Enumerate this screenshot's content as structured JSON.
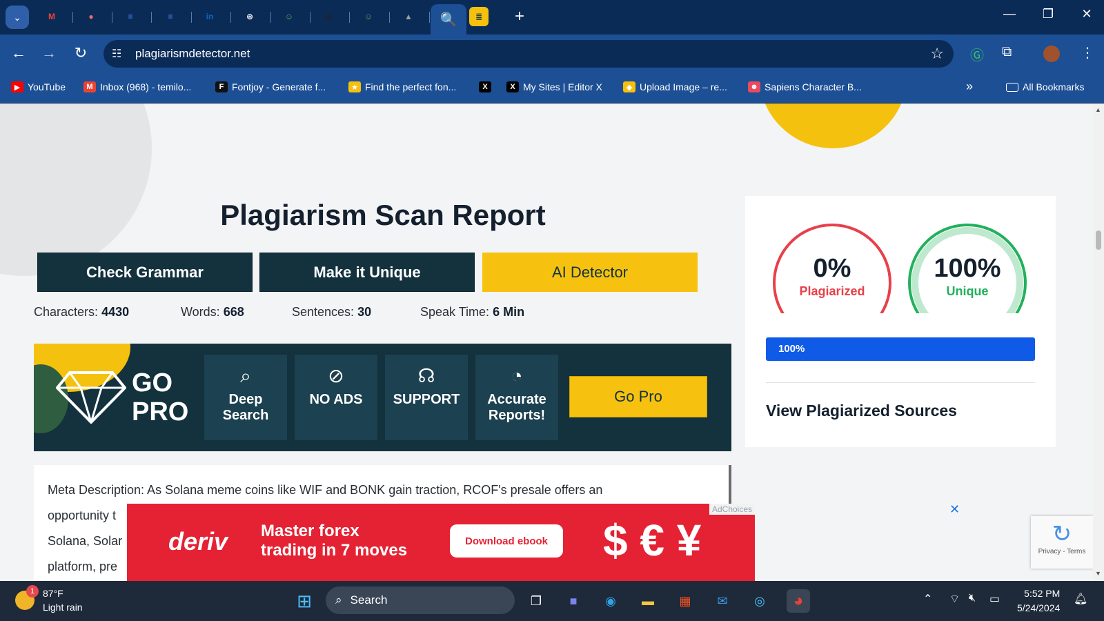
{
  "browser": {
    "url": "plagiarismdetector.net",
    "tabs": [
      {
        "name": "gmail",
        "glyph": "M",
        "color": "#ea4335"
      },
      {
        "name": "asana",
        "glyph": "●",
        "color": "#f06a6a"
      },
      {
        "name": "docs-1",
        "glyph": "≡",
        "color": "#4285f4"
      },
      {
        "name": "docs-2",
        "glyph": "≡",
        "color": "#4285f4"
      },
      {
        "name": "linkedin",
        "glyph": "in",
        "color": "#0a66c2"
      },
      {
        "name": "chatgpt",
        "glyph": "⊛",
        "color": "#ffffff"
      },
      {
        "name": "robot-1",
        "glyph": "☺",
        "color": "#4caf50"
      },
      {
        "name": "globe",
        "glyph": "◍",
        "color": "#222222"
      },
      {
        "name": "robot-2",
        "glyph": "☺",
        "color": "#4caf50"
      },
      {
        "name": "drive",
        "glyph": "▲",
        "color": "#9e9e9e"
      },
      {
        "name": "notes",
        "glyph": "≡",
        "color": "#f5c10f"
      }
    ],
    "active_tab_glyph": "🔍",
    "new_tab": "+",
    "bookmarks": [
      {
        "label": "YouTube",
        "glyph": "▶",
        "color": "#ff0000"
      },
      {
        "label": "Inbox (968) - temilo...",
        "glyph": "M",
        "color": "#ea4335"
      },
      {
        "label": "Fontjoy - Generate f...",
        "glyph": "F",
        "color": "#111111"
      },
      {
        "label": "Find the perfect fon...",
        "glyph": "★",
        "color": "#f5c10f"
      },
      {
        "label": "",
        "glyph": "X",
        "color": "#000000"
      },
      {
        "label": "My Sites | Editor X",
        "glyph": "X",
        "color": "#000000"
      },
      {
        "label": "Upload Image – re...",
        "glyph": "◆",
        "color": "#f5c10f"
      },
      {
        "label": "Sapiens Character B...",
        "glyph": "☻",
        "color": "#e84a5f"
      }
    ],
    "bookmarks_overflow": "»",
    "all_bookmarks": "All Bookmarks"
  },
  "page": {
    "title": "Plagiarism Scan Report",
    "buttons": {
      "grammar": "Check Grammar",
      "unique": "Make it Unique",
      "ai": "AI Detector"
    },
    "stats": {
      "characters_label": "Characters:",
      "characters": "4430",
      "words_label": "Words:",
      "words": "668",
      "sentences_label": "Sentences:",
      "sentences": "30",
      "speak_label": "Speak Time:",
      "speak": "6 Min"
    },
    "gopro": {
      "title_line1": "GO",
      "title_line2": "PRO",
      "features": [
        {
          "label_line1": "Deep",
          "label_line2": "Search",
          "icon": "search-icon"
        },
        {
          "label_line1": "NO ADS",
          "label_line2": "",
          "icon": "no-ads-icon"
        },
        {
          "label_line1": "SUPPORT",
          "label_line2": "",
          "icon": "headset-icon"
        },
        {
          "label_line1": "Accurate",
          "label_line2": "Reports!",
          "icon": "pie-chart-icon"
        }
      ],
      "button": "Go Pro"
    },
    "content_lines": [
      "Meta Description: As Solana meme coins like WIF and BONK gain traction, RCOF's presale offers an",
      "opportunity t",
      "Solana, Solar",
      "platform, pre"
    ],
    "result": {
      "plagiarized_value": "0%",
      "plagiarized_label": "Plagiarized",
      "plagiarized_fraction": 0.0,
      "unique_value": "100%",
      "unique_label": "Unique",
      "unique_fraction": 1.0,
      "progress_label": "100%",
      "progress_fraction": 1.0,
      "sources_title": "View Plagiarized Sources"
    },
    "colors": {
      "dark_teal": "#13323e",
      "accent_yellow": "#f7c20f",
      "plagiarized_red": "#e8404a",
      "unique_green": "#22b05c",
      "progress_blue": "#0f5be8"
    }
  },
  "ad": {
    "brand": "deriv",
    "headline_line1": "Master forex",
    "headline_line2": "trading in 7 moves",
    "cta": "Download ebook",
    "choices": "AdChoices",
    "close": "✕",
    "art": "$ € ¥"
  },
  "recaptcha": {
    "links": "Privacy - Terms"
  },
  "taskbar": {
    "weather_badge": "1",
    "temperature": "87°F",
    "condition": "Light rain",
    "search_placeholder": "Search",
    "time": "5:52 PM",
    "date": "5/24/2024"
  }
}
